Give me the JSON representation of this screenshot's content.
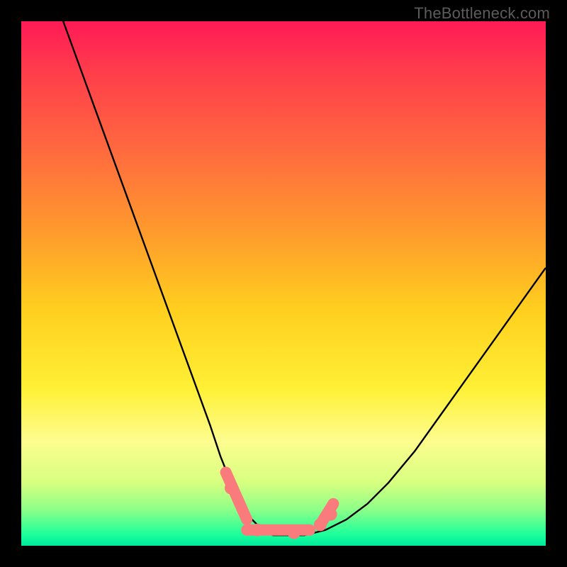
{
  "watermark": "TheBottleneck.com",
  "chart_data": {
    "type": "line",
    "title": "",
    "xlabel": "",
    "ylabel": "",
    "xlim": [
      0,
      100
    ],
    "ylim": [
      0,
      100
    ],
    "series": [
      {
        "name": "curve",
        "x": [
          8,
          12,
          16,
          20,
          24,
          28,
          32,
          36,
          38,
          40,
          42,
          44,
          46,
          48,
          50,
          54,
          58,
          62,
          66,
          70,
          75,
          80,
          85,
          90,
          95,
          100
        ],
        "values": [
          100,
          89,
          78,
          67,
          56,
          45,
          34,
          23,
          17,
          12,
          8,
          5,
          3,
          2,
          2,
          2,
          3,
          5,
          8,
          12,
          18,
          25,
          32,
          39,
          46,
          53
        ]
      }
    ],
    "annotations": [
      {
        "name": "dot-left",
        "x": 40.0,
        "y": 11.0
      },
      {
        "name": "dot-flat-a",
        "x": 45.0,
        "y": 3.0
      },
      {
        "name": "dot-flat-b",
        "x": 52.0,
        "y": 2.5
      },
      {
        "name": "dot-right-a",
        "x": 57.0,
        "y": 4.0
      },
      {
        "name": "dot-right-b",
        "x": 59.0,
        "y": 6.0
      }
    ],
    "worm": [
      {
        "name": "worm-left",
        "from": {
          "x": 39,
          "y": 14
        },
        "to": {
          "x": 43,
          "y": 5
        }
      },
      {
        "name": "worm-flat",
        "from": {
          "x": 43,
          "y": 3
        },
        "to": {
          "x": 55,
          "y": 3
        }
      },
      {
        "name": "worm-right",
        "from": {
          "x": 57,
          "y": 4
        },
        "to": {
          "x": 59.5,
          "y": 8
        }
      }
    ],
    "colors": {
      "curve": "#000000",
      "worm": "#f97b7b",
      "dot": "#f97b7b"
    }
  }
}
